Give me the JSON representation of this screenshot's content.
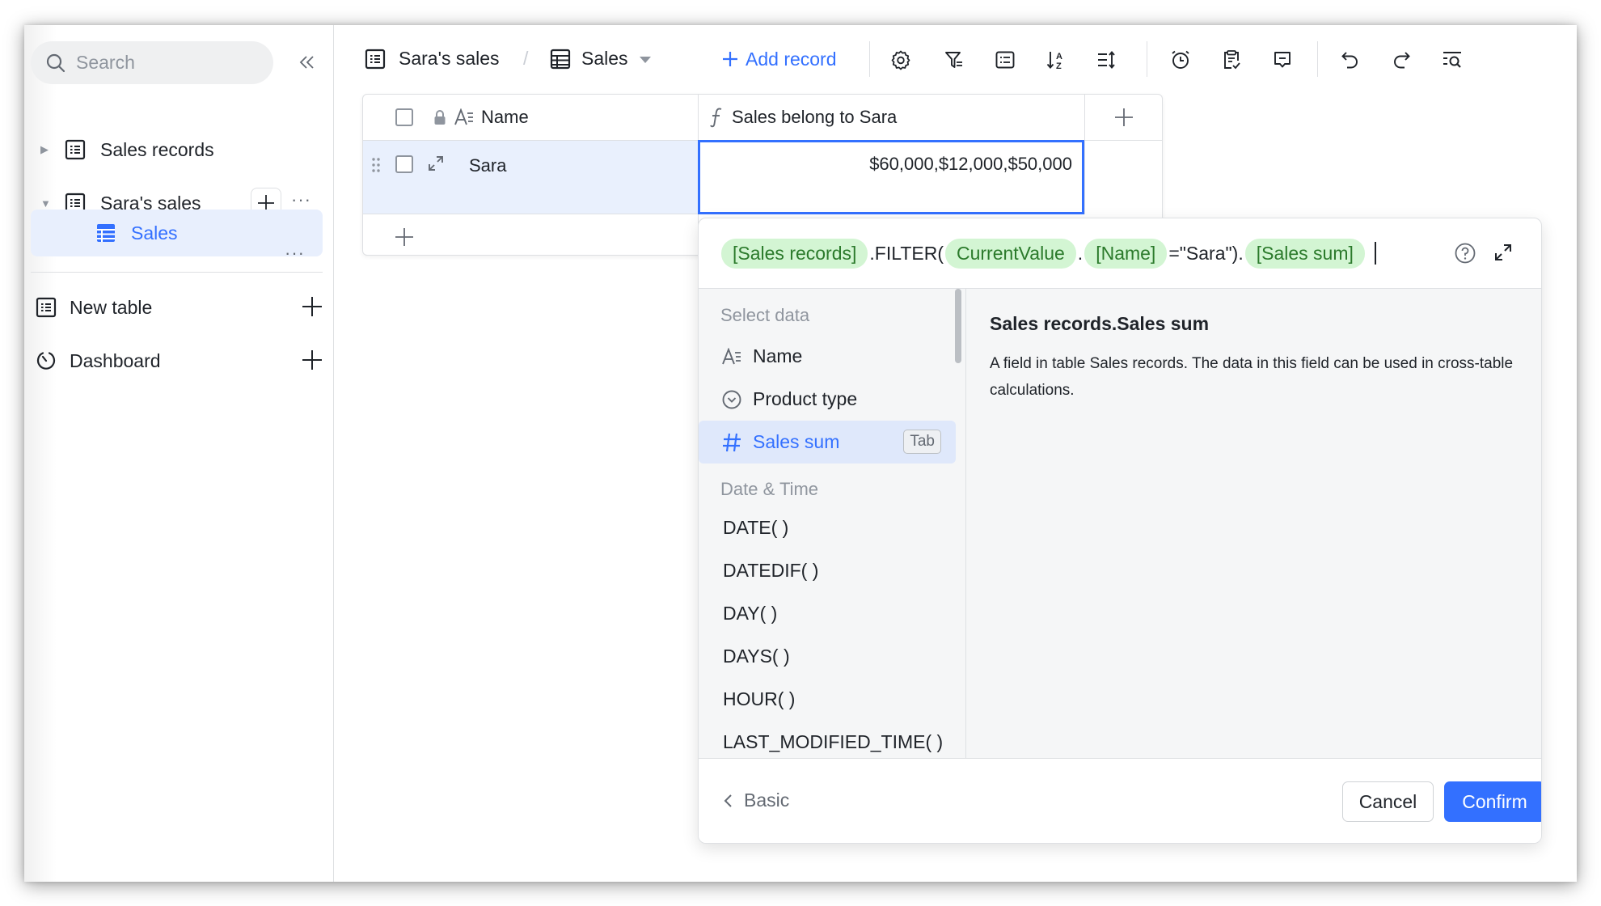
{
  "sidebar": {
    "search_placeholder": "Search",
    "collapse_icon": "double-chevron-left-icon",
    "items": [
      {
        "label": "Sales records",
        "icon": "table-icon",
        "expanded": false
      },
      {
        "label": "Sara's sales",
        "icon": "table-icon",
        "expanded": true
      },
      {
        "label": "Sales",
        "icon": "grid-view-icon",
        "active": true
      }
    ],
    "new_table_label": "New table",
    "dashboard_label": "Dashboard"
  },
  "toolbar": {
    "breadcrumb_table": "Sara's sales",
    "breadcrumb_separator": "/",
    "view_name": "Sales",
    "add_record_label": "Add record",
    "icons": [
      "settings-icon",
      "filter-icon",
      "group-icon",
      "sort-icon",
      "row-height-icon",
      "alarm-icon",
      "clipboard-check-icon",
      "comment-icon",
      "undo-icon",
      "redo-icon",
      "search-records-icon"
    ]
  },
  "table": {
    "columns": [
      {
        "label": "Name",
        "type_icon": "text-field-icon",
        "locked": true
      },
      {
        "label": "Sales belong to Sara",
        "type_icon": "formula-icon"
      }
    ],
    "rows": [
      {
        "name": "Sara",
        "sales_belong_to_sara": "$60,000,$12,000,$50,000"
      }
    ]
  },
  "formula": {
    "tokens": [
      {
        "type": "pill",
        "text": "[Sales records]"
      },
      {
        "type": "text",
        "text": ".FILTER("
      },
      {
        "type": "pill",
        "text": "CurrentValue"
      },
      {
        "type": "text",
        "text": "."
      },
      {
        "type": "pill",
        "text": "[Name]"
      },
      {
        "type": "text",
        "text": "=\"Sara\")."
      },
      {
        "type": "pill",
        "text": "[Sales sum]"
      }
    ],
    "select_data_heading": "Select data",
    "fields": [
      {
        "label": "Name",
        "icon": "text-field-icon"
      },
      {
        "label": "Product type",
        "icon": "single-select-icon"
      },
      {
        "label": "Sales sum",
        "icon": "number-icon",
        "active": true,
        "key_hint": "Tab"
      }
    ],
    "date_time_heading": "Date & Time",
    "functions": [
      "DATE( )",
      "DATEDIF( )",
      "DAY( )",
      "DAYS( )",
      "HOUR( )",
      "LAST_MODIFIED_TIME( )"
    ],
    "detail_title": "Sales records.Sales sum",
    "detail_description": "A field in table Sales records. The data in this field can be used in cross-table calculations.",
    "back_label": "Basic",
    "cancel_label": "Cancel",
    "confirm_label": "Confirm"
  },
  "colors": {
    "accent": "#3370ff",
    "pill_bg": "#d3f5d3",
    "pill_text": "#2b7a2b",
    "selected_row_bg": "#e9f0fd"
  }
}
